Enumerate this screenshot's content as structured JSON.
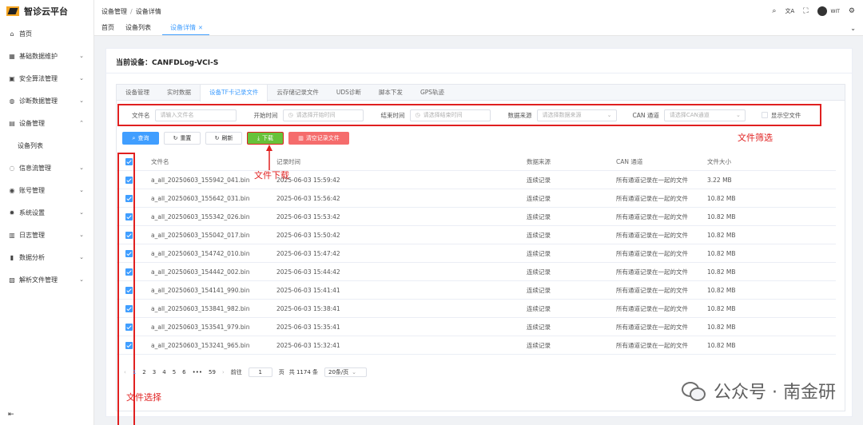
{
  "app": {
    "name": "智诊云平台"
  },
  "sidebar": {
    "items": [
      {
        "label": "首页",
        "icon": "home-icon",
        "glyph": "⌂",
        "chevron": false
      },
      {
        "label": "基础数据维护",
        "icon": "grid-icon",
        "glyph": "▦",
        "chevron": true
      },
      {
        "label": "安全算法管理",
        "icon": "briefcase-icon",
        "glyph": "▣",
        "chevron": true
      },
      {
        "label": "诊断数据管理",
        "icon": "monitor-icon",
        "glyph": "◍",
        "chevron": true
      },
      {
        "label": "设备管理",
        "icon": "device-icon",
        "glyph": "▤",
        "chevron": true,
        "expanded": true
      }
    ],
    "sub_item": "设备列表",
    "items_after": [
      {
        "label": "信息流管理",
        "icon": "chat-icon",
        "glyph": "◌",
        "chevron": true
      },
      {
        "label": "账号管理",
        "icon": "user-icon",
        "glyph": "◉",
        "chevron": true
      },
      {
        "label": "系统设置",
        "icon": "settings-icon",
        "glyph": "✹",
        "chevron": true
      },
      {
        "label": "日志管理",
        "icon": "log-icon",
        "glyph": "▥",
        "chevron": true
      },
      {
        "label": "数据分析",
        "icon": "chart-icon",
        "glyph": "▮",
        "chevron": true
      },
      {
        "label": "解析文件管理",
        "icon": "file-icon",
        "glyph": "▧",
        "chevron": true
      }
    ],
    "collapse_glyph": "⇤"
  },
  "header": {
    "breadcrumb": [
      "设备管理",
      "设备详情"
    ],
    "user_label": "WIT",
    "tools": {
      "search": "⌕",
      "translate": "文A",
      "fullscreen": "⛶",
      "settings": "⚙"
    }
  },
  "tags": [
    {
      "label": "首页",
      "active": false
    },
    {
      "label": "设备列表",
      "active": false
    },
    {
      "label": "设备详情",
      "active": true
    }
  ],
  "device": {
    "label": "当前设备：",
    "name": "CANFDLog-VCI-S"
  },
  "tabs": [
    "设备管理",
    "实时数据",
    "设备TF卡记录文件",
    "云存储记录文件",
    "UDS诊断",
    "脚本下发",
    "GPS轨迹"
  ],
  "active_tab_index": 2,
  "filter": {
    "file_name_label": "文件名",
    "file_name_placeholder": "请输入文件名",
    "start_label": "开始时间",
    "start_placeholder": "请选择开始时间",
    "end_label": "结束时间",
    "end_placeholder": "请选择结束时间",
    "source_label": "数据来源",
    "source_placeholder": "请选择数据来源",
    "can_label": "CAN 通道",
    "can_placeholder": "请选择CAN通道",
    "show_empty_label": "显示空文件"
  },
  "annotations": {
    "filter": "文件筛选",
    "download": "文件下载",
    "select": "文件选择"
  },
  "buttons": {
    "query": "查询",
    "reset": "重置",
    "refresh": "刷新",
    "download": "下载",
    "clear": "清空记录文件"
  },
  "table": {
    "columns": [
      "文件名",
      "记录时间",
      "数据来源",
      "CAN 通道",
      "文件大小"
    ],
    "rows": [
      [
        "a_all_20250603_155942_041.bin",
        "2025-06-03 15:59:42",
        "连续记录",
        "所有通道记录在一起的文件",
        "3.22 MB"
      ],
      [
        "a_all_20250603_155642_031.bin",
        "2025-06-03 15:56:42",
        "连续记录",
        "所有通道记录在一起的文件",
        "10.82 MB"
      ],
      [
        "a_all_20250603_155342_026.bin",
        "2025-06-03 15:53:42",
        "连续记录",
        "所有通道记录在一起的文件",
        "10.82 MB"
      ],
      [
        "a_all_20250603_155042_017.bin",
        "2025-06-03 15:50:42",
        "连续记录",
        "所有通道记录在一起的文件",
        "10.82 MB"
      ],
      [
        "a_all_20250603_154742_010.bin",
        "2025-06-03 15:47:42",
        "连续记录",
        "所有通道记录在一起的文件",
        "10.82 MB"
      ],
      [
        "a_all_20250603_154442_002.bin",
        "2025-06-03 15:44:42",
        "连续记录",
        "所有通道记录在一起的文件",
        "10.82 MB"
      ],
      [
        "a_all_20250603_154141_990.bin",
        "2025-06-03 15:41:41",
        "连续记录",
        "所有通道记录在一起的文件",
        "10.82 MB"
      ],
      [
        "a_all_20250603_153841_982.bin",
        "2025-06-03 15:38:41",
        "连续记录",
        "所有通道记录在一起的文件",
        "10.82 MB"
      ],
      [
        "a_all_20250603_153541_979.bin",
        "2025-06-03 15:35:41",
        "连续记录",
        "所有通道记录在一起的文件",
        "10.82 MB"
      ],
      [
        "a_all_20250603_153241_965.bin",
        "2025-06-03 15:32:41",
        "连续记录",
        "所有通道记录在一起的文件",
        "10.82 MB"
      ]
    ]
  },
  "pager": {
    "pages": [
      "1",
      "2",
      "3",
      "4",
      "5",
      "6",
      "•••",
      "59"
    ],
    "goto_label": "前往",
    "goto_value": "1",
    "page_unit": "页",
    "total": "共 1174 条",
    "page_size": "20条/页"
  },
  "watermark": {
    "text": "公众号 · 南金研"
  },
  "colors": {
    "primary": "#409eff",
    "success": "#67c23a",
    "danger": "#f56c6c",
    "annotation": "#e02020"
  }
}
